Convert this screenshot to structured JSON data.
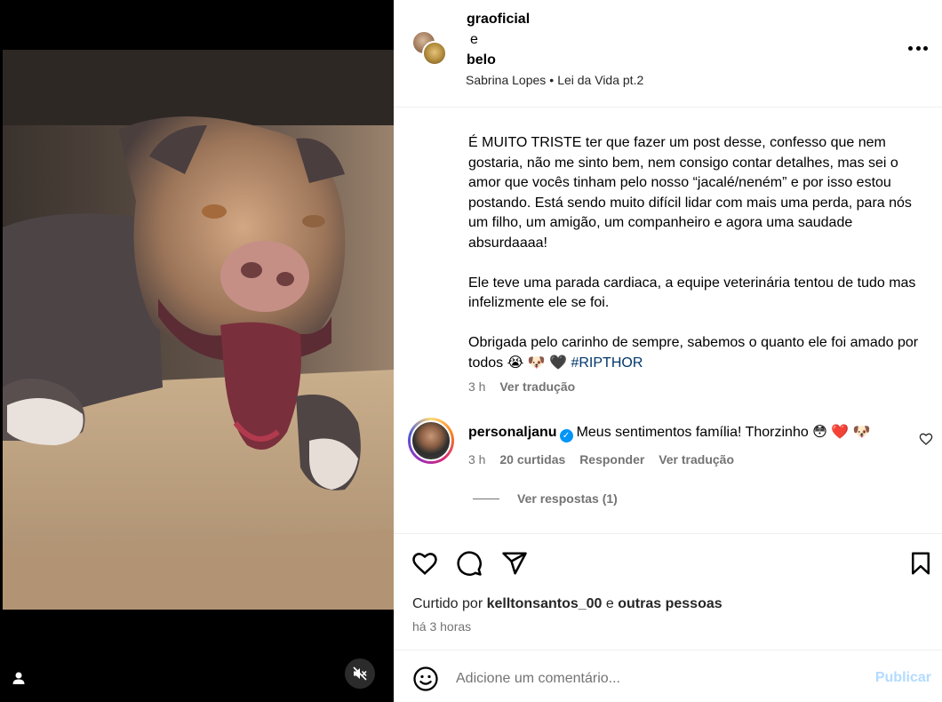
{
  "post": {
    "authors": [
      "graoficial",
      "belo"
    ],
    "authors_joiner": "e",
    "audio": {
      "artist": "Sabrina Lopes",
      "track": "Lei da Vida pt.2",
      "separator": "•"
    }
  },
  "caption": {
    "paragraphs": [
      "É MUITO TRISTE ter que fazer um post desse, confesso que nem gostaria, não me sinto bem, nem consigo contar detalhes, mas sei o amor que vocês tinham pelo nosso “jacalé/neném” e por isso estou postando. Está sendo muito difícil lidar com mais uma perda, para nós um filho, um amigão, um companheiro e agora uma saudade absurdaaaa!",
      "Ele teve uma parada cardiaca, a equipe veterinária tentou de tudo mas infelizmente ele se foi."
    ],
    "last_paragraph_text": "Obrigada pelo carinho de sempre, sabemos o quanto ele foi amado por todos 😭 🐶 🖤 ",
    "hashtag": "#RIPTHOR",
    "time": "3 h",
    "translate_label": "Ver tradução"
  },
  "comment": {
    "username": "personaljanu",
    "verified": true,
    "text": "Meus sentimentos família! Thorzinho 😳 ❤️ 🐶",
    "time": "3 h",
    "likes": "20 curtidas",
    "reply_label": "Responder",
    "translate_label": "Ver tradução",
    "view_replies": "Ver respostas (1)"
  },
  "likes": {
    "prefix": "Curtido por",
    "user": "kelltonsantos_00",
    "joiner": "e",
    "others": "outras pessoas"
  },
  "timestamp": "há 3 horas",
  "composer": {
    "placeholder": "Adicione um comentário...",
    "publish_label": "Publicar"
  },
  "colors": {
    "link": "#00376b",
    "verified": "#0095f6",
    "publish_disabled": "#b3dbff",
    "secondary_text": "#737373"
  },
  "icons": {
    "like": "heart-outline-icon",
    "comment": "comment-bubble-icon",
    "share": "paper-plane-icon",
    "save": "bookmark-icon",
    "emoji": "smiley-icon",
    "more": "ellipsis-icon",
    "mute": "speaker-muted-icon",
    "tagged_users": "user-icon"
  }
}
